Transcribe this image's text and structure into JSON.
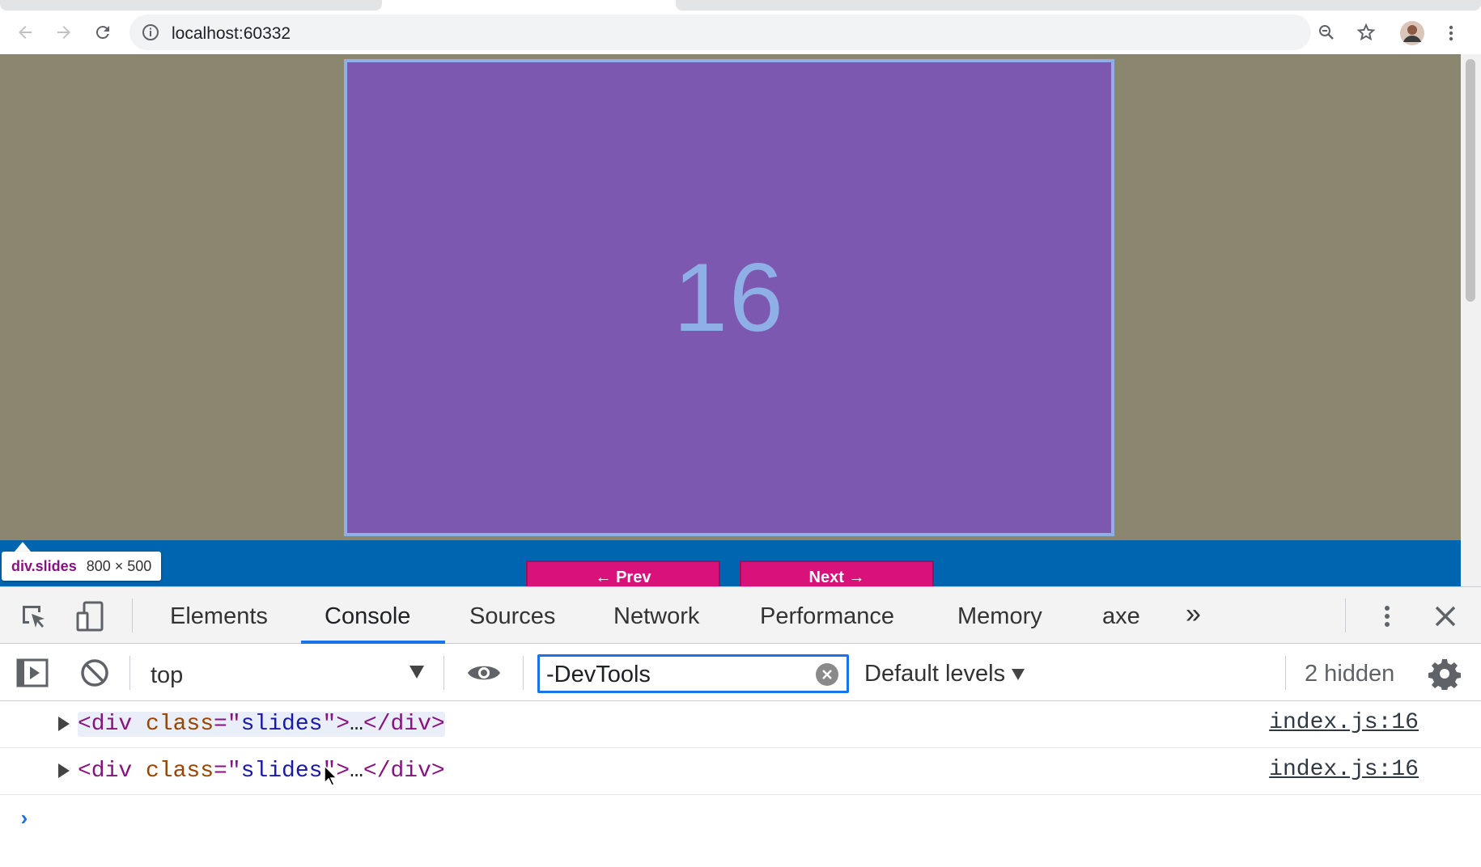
{
  "browser": {
    "url": "localhost:60332",
    "nav": {
      "back": "back-arrow-icon",
      "forward": "forward-arrow-icon",
      "reload": "reload-icon"
    },
    "toolbar_icons": [
      "zoom-icon",
      "bookmark-star-icon",
      "profile-avatar",
      "chrome-menu-icon"
    ]
  },
  "page": {
    "slide_number": "16",
    "prev_button": "← Prev",
    "next_button": "Next →",
    "inspect_tooltip": {
      "selector_tag": "div",
      "selector_class": ".slides",
      "dimensions": "800 × 500"
    },
    "colors": {
      "background": "#8b8670",
      "slide": "#7c58b0",
      "slide_border": "#8fb0e6",
      "band": "#0065b0",
      "button": "#d8127a"
    }
  },
  "devtools": {
    "tabs": [
      "Elements",
      "Console",
      "Sources",
      "Network",
      "Performance",
      "Memory",
      "axe"
    ],
    "active_tab": "Console",
    "more_tabs": "»",
    "console_toolbar": {
      "context": "top",
      "filter_value": "-DevTools",
      "levels": "Default levels",
      "hidden": "2 hidden"
    },
    "messages": [
      {
        "tag_open": "<div ",
        "attr": "class",
        "eq": "=\"",
        "value": "slides",
        "close": "\">",
        "ellipsis": "…",
        "tag_close": "</div>",
        "source": "index.js:16"
      },
      {
        "tag_open": "<div ",
        "attr": "class",
        "eq": "=\"",
        "value": "slides",
        "close": "\">",
        "ellipsis": "…",
        "tag_close": "</div>",
        "source": "index.js:16"
      }
    ],
    "prompt": "›"
  }
}
